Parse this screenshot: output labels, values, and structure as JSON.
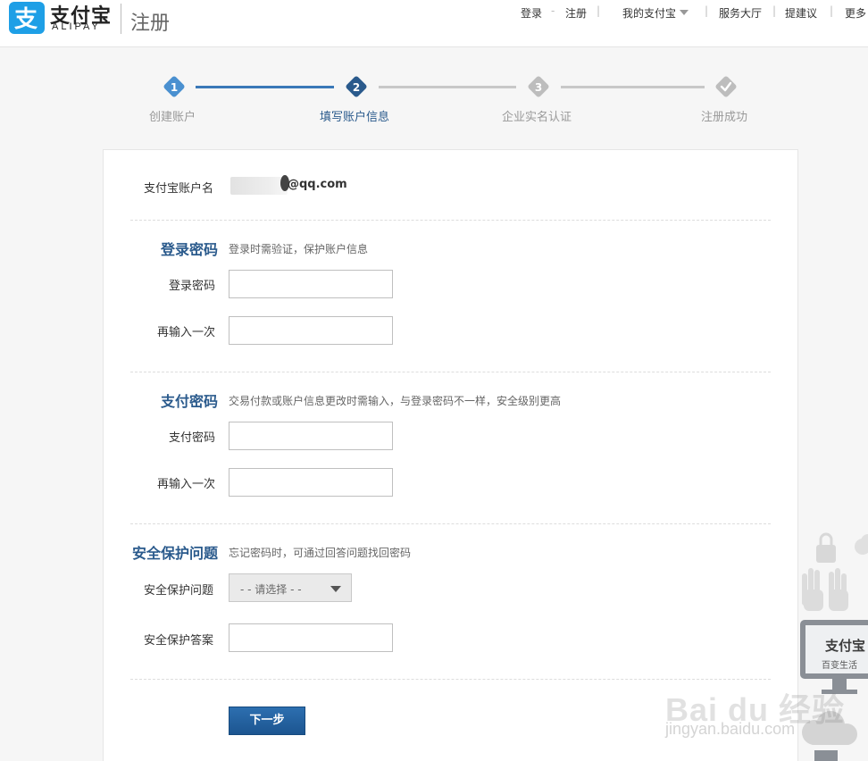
{
  "header": {
    "logo_cn": "支付宝",
    "logo_en": "ALIPAY",
    "page_title": "注册",
    "nav": {
      "login": "登录",
      "separator": "-",
      "register": "注册",
      "my_alipay": "我的支付宝",
      "service_hall": "服务大厅",
      "feedback": "提建议",
      "more": "更多"
    }
  },
  "steps": [
    {
      "number": "1",
      "label": "创建账户",
      "state": "done"
    },
    {
      "number": "2",
      "label": "填写账户信息",
      "state": "active"
    },
    {
      "number": "3",
      "label": "企业实名认证",
      "state": "pending"
    },
    {
      "number": "",
      "label": "注册成功",
      "state": "pending"
    }
  ],
  "account": {
    "label": "支付宝账户名",
    "value_visible": "@qq.com"
  },
  "login_password": {
    "title": "登录密码",
    "desc": "登录时需验证，保护账户信息",
    "password_label": "登录密码",
    "password_value": "",
    "confirm_label": "再输入一次",
    "confirm_value": ""
  },
  "pay_password": {
    "title": "支付密码",
    "desc": "交易付款或账户信息更改时需输入，与登录密码不一样，安全级别更高",
    "password_label": "支付密码",
    "password_value": "",
    "confirm_label": "再输入一次",
    "confirm_value": ""
  },
  "security": {
    "title": "安全保护问题",
    "desc": "忘记密码时，可通过回答问题找回密码",
    "question_label": "安全保护问题",
    "question_selected": "- - 请选择 - -",
    "answer_label": "安全保护答案",
    "answer_value": ""
  },
  "next_button": "下一步",
  "decoration": {
    "monitor_brand": "支付宝",
    "monitor_slogan": "百变生活"
  },
  "watermark": {
    "main": "Bai du 经验",
    "sub": "jingyan.baidu.com"
  },
  "colors": {
    "brand_blue": "#1e9fe6",
    "step_active": "#2a5a8c",
    "step_done": "#4a90d0",
    "section_title": "#2a5a8c"
  }
}
